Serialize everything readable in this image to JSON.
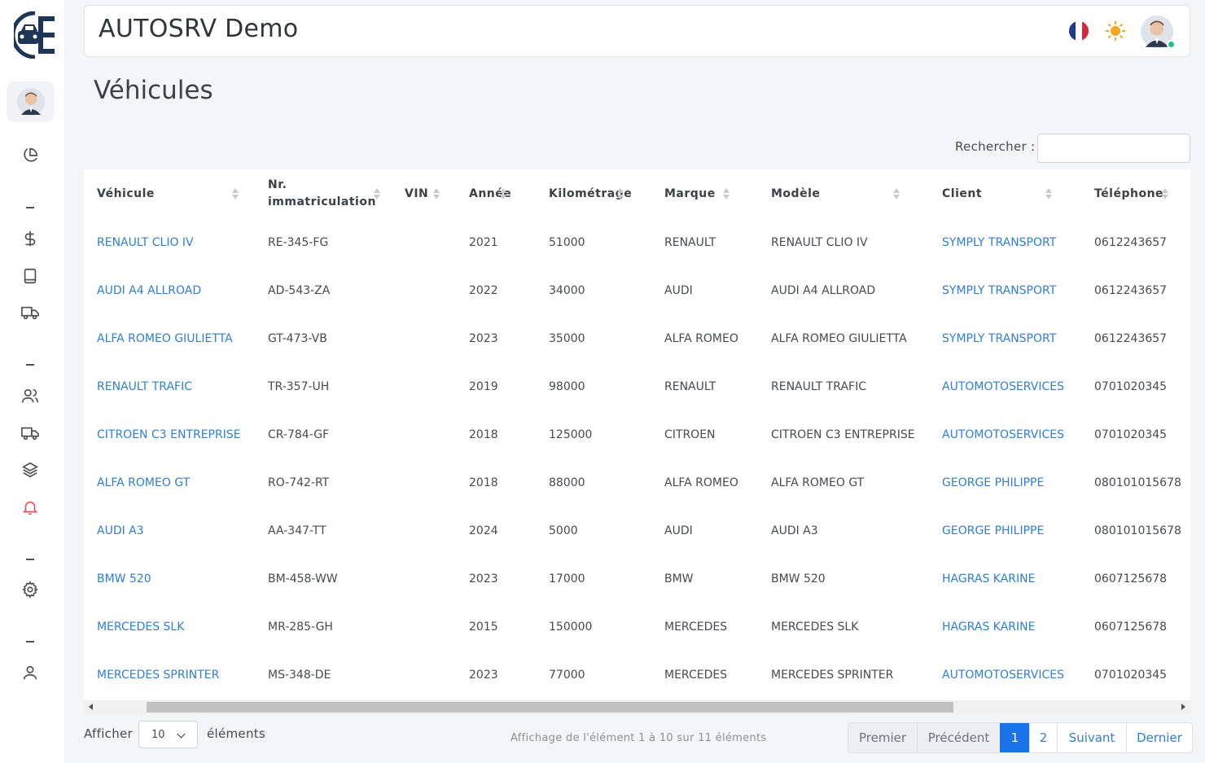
{
  "header": {
    "app_title": "AUTOSRV Demo"
  },
  "page": {
    "title": "Véhicules"
  },
  "search": {
    "label": "Rechercher :",
    "value": "",
    "placeholder": ""
  },
  "sidebar": {
    "icons": [
      "pie-chart-icon",
      "dollar-icon",
      "book-icon",
      "truck-icon",
      "users-icon",
      "truck-icon",
      "layers-icon",
      "bell-icon",
      "gear-icon",
      "user-icon"
    ]
  },
  "table": {
    "columns": [
      "Véhicule",
      "Nr. immatriculation",
      "VIN",
      "Année",
      "Kilométrage",
      "Marque",
      "Modèle",
      "Client",
      "Téléphone"
    ],
    "rows": [
      [
        "RENAULT CLIO IV",
        "RE-345-FG",
        "",
        "2021",
        "51000",
        "RENAULT",
        "RENAULT CLIO IV",
        "SYMPLY TRANSPORT",
        "0612243657"
      ],
      [
        "AUDI A4 ALLROAD",
        "AD-543-ZA",
        "",
        "2022",
        "34000",
        "AUDI",
        "AUDI A4 ALLROAD",
        "SYMPLY TRANSPORT",
        "0612243657"
      ],
      [
        "ALFA ROMEO GIULIETTA",
        "GT-473-VB",
        "",
        "2023",
        "35000",
        "ALFA ROMEO",
        "ALFA ROMEO GIULIETTA",
        "SYMPLY TRANSPORT",
        "0612243657"
      ],
      [
        "RENAULT TRAFIC",
        "TR-357-UH",
        "",
        "2019",
        "98000",
        "RENAULT",
        "RENAULT TRAFIC",
        "AUTOMOTOSERVICES",
        "0701020345"
      ],
      [
        "CITROEN C3 ENTREPRISE",
        "CR-784-GF",
        "",
        "2018",
        "125000",
        "CITROEN",
        "CITROEN C3 ENTREPRISE",
        "AUTOMOTOSERVICES",
        "0701020345"
      ],
      [
        "ALFA ROMEO GT",
        "RO-742-RT",
        "",
        "2018",
        "88000",
        "ALFA ROMEO",
        "ALFA ROMEO GT",
        "GEORGE PHILIPPE",
        "080101015678"
      ],
      [
        "AUDI A3",
        "AA-347-TT",
        "",
        "2024",
        "5000",
        "AUDI",
        "AUDI A3",
        "GEORGE PHILIPPE",
        "080101015678"
      ],
      [
        "BMW 520",
        "BM-458-WW",
        "",
        "2023",
        "17000",
        "BMW",
        "BMW 520",
        "HAGRAS KARINE",
        "0607125678"
      ],
      [
        "MERCEDES SLK",
        "MR-285-GH",
        "",
        "2015",
        "150000",
        "MERCEDES",
        "MERCEDES SLK",
        "HAGRAS KARINE",
        "0607125678"
      ],
      [
        "MERCEDES SPRINTER",
        "MS-348-DE",
        "",
        "2023",
        "77000",
        "MERCEDES",
        "MERCEDES SPRINTER",
        "AUTOMOTOSERVICES",
        "0701020345"
      ]
    ]
  },
  "length": {
    "label_before": "Afficher",
    "value": "10",
    "label_after": "éléments"
  },
  "info": "Affichage de l'élément 1 à 10 sur 11 éléments",
  "pagination": {
    "first": "Premier",
    "previous": "Précédent",
    "page1": "1",
    "page2": "2",
    "next": "Suivant",
    "last": "Dernier"
  },
  "colors": {
    "link": "#2e7fd8",
    "active_page": "#1a73e8",
    "bell": "#e8505b"
  }
}
